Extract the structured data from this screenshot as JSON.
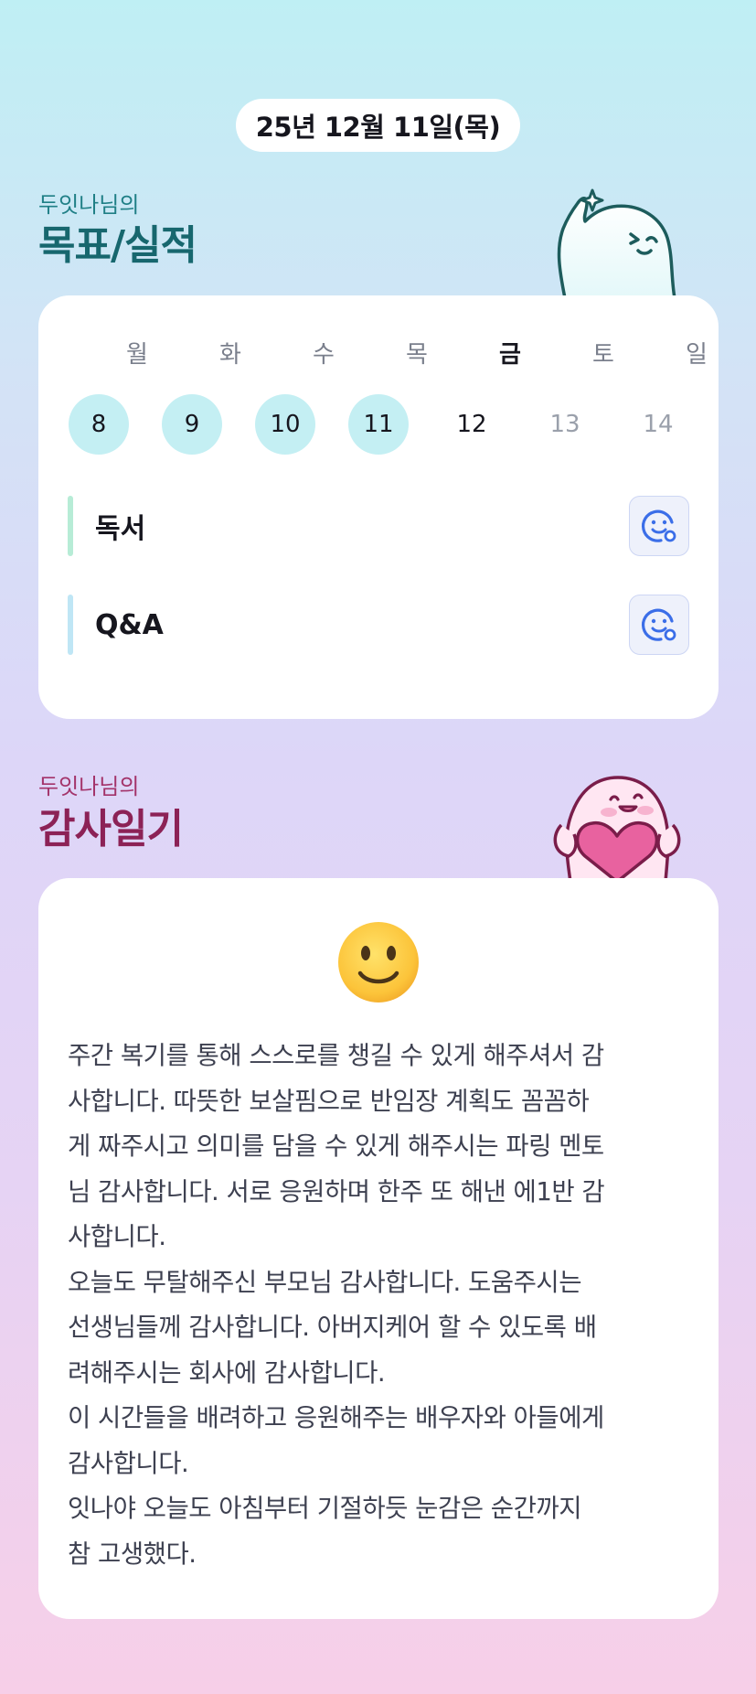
{
  "header": {
    "date": "25년 12월 11일(목)"
  },
  "goal_section": {
    "subtitle": "두잇나님의",
    "title": "목표/실적",
    "weekdays": [
      "월",
      "화",
      "수",
      "목",
      "금",
      "토",
      "일"
    ],
    "dates": [
      "8",
      "9",
      "10",
      "11",
      "12",
      "13",
      "14"
    ],
    "date_states": [
      "done",
      "done",
      "done",
      "done",
      "today",
      "future",
      "future"
    ],
    "items": [
      {
        "label": "독서",
        "bar_color": "#b7ecd6",
        "icon": "smile-feedback-icon"
      },
      {
        "label": "Q&A",
        "bar_color": "#bfe6f5",
        "icon": "smile-feedback-icon"
      }
    ]
  },
  "thanks_section": {
    "subtitle": "두잇나님의",
    "title": "감사일기",
    "mood_icon": "slightly-smiling-face-emoji",
    "text": "주간 복기를 통해 스스로를 챙길 수 있게 해주셔서 감\n사합니다. 따뜻한 보살핌으로 반임장 계획도 꼼꼼하\n게 짜주시고 의미를 담을 수 있게 해주시는 파링 멘토\n님 감사합니다. 서로 응원하며 한주 또 해낸 에1반 감\n사합니다.\n오늘도 무탈해주신 부모님 감사합니다. 도움주시는\n선생님들께 감사합니다. 아버지케어 할 수 있도록 배\n려해주시는 회사에 감사합니다.\n이 시간들을 배려하고 응원해주는 배우자와 아들에게\n감사합니다.\n잇나야 오늘도 아침부터 기절하듯 눈감은 순간까지\n참 고생했다."
  },
  "colors": {
    "goal_title": "#17676e",
    "thanks_title": "#8c2256",
    "done_circle": "#c4eff3",
    "icon_blue": "#3b6ee8"
  }
}
